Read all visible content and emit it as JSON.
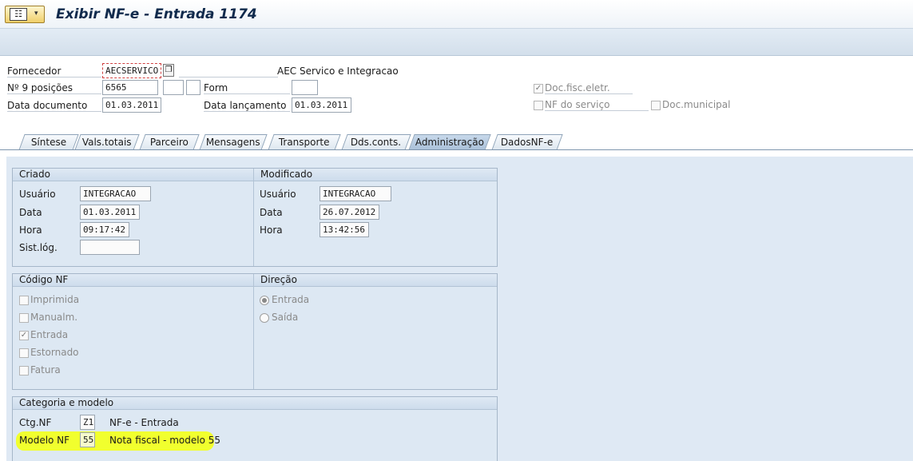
{
  "window": {
    "title": "Exibir NF-e - Entrada 1174"
  },
  "header": {
    "fornecedor_label": "Fornecedor",
    "fornecedor_value": "AECSERVICO",
    "fornecedor_name": "AEC Servico e Integracao",
    "n9_label": "Nº 9 posições",
    "n9_value": "6565",
    "form_label": "Form",
    "form_value": "",
    "data_doc_label": "Data documento",
    "data_doc_value": "01.03.2011",
    "data_lanc_label": "Data lançamento",
    "data_lanc_value": "01.03.2011",
    "doc_fisc_label": "Doc.fisc.eletr.",
    "doc_fisc_checked": true,
    "nf_servico_label": "NF do serviço",
    "doc_municipal_label": "Doc.municipal"
  },
  "tabs": [
    {
      "label": "Síntese"
    },
    {
      "label": "Vals.totais"
    },
    {
      "label": "Parceiro"
    },
    {
      "label": "Mensagens"
    },
    {
      "label": "Transporte"
    },
    {
      "label": "Dds.conts."
    },
    {
      "label": "Administração",
      "active": true
    },
    {
      "label": "DadosNF-e"
    }
  ],
  "criado": {
    "title": "Criado",
    "usuario_label": "Usuário",
    "usuario_value": "INTEGRACAO",
    "data_label": "Data",
    "data_value": "01.03.2011",
    "hora_label": "Hora",
    "hora_value": "09:17:42",
    "sistlog_label": "Sist.lóg.",
    "sistlog_value": ""
  },
  "modificado": {
    "title": "Modificado",
    "usuario_label": "Usuário",
    "usuario_value": "INTEGRACAO",
    "data_label": "Data",
    "data_value": "26.07.2012",
    "hora_label": "Hora",
    "hora_value": "13:42:56"
  },
  "codigo_nf": {
    "title": "Código NF",
    "items": [
      {
        "label": "Imprimida",
        "checked": false
      },
      {
        "label": "Manualm.",
        "checked": false
      },
      {
        "label": "Entrada",
        "checked": true
      },
      {
        "label": "Estornado",
        "checked": false
      },
      {
        "label": "Fatura",
        "checked": false
      }
    ]
  },
  "direcao": {
    "title": "Direção",
    "options": [
      {
        "label": "Entrada",
        "selected": true
      },
      {
        "label": "Saída",
        "selected": false
      }
    ]
  },
  "categoria": {
    "title": "Categoria e modelo",
    "ctg_label": "Ctg.NF",
    "ctg_value": "Z1",
    "ctg_desc": "NF-e - Entrada",
    "modelo_label": "Modelo NF",
    "modelo_value": "55",
    "modelo_desc": "Nota fiscal - modelo 55",
    "highlight_color": "#f1ff2e"
  }
}
